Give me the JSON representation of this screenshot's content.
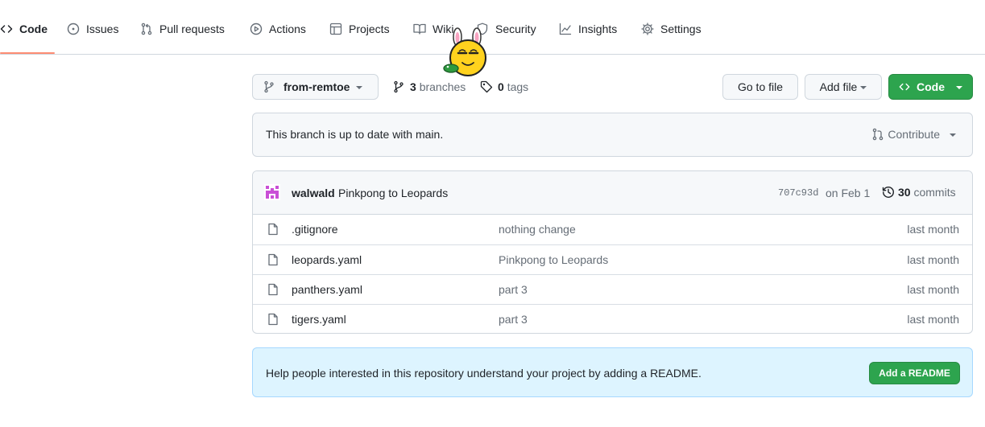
{
  "nav": {
    "items": [
      {
        "label": "Code",
        "icon": "code-icon",
        "selected": true
      },
      {
        "label": "Issues",
        "icon": "issue-opened-icon"
      },
      {
        "label": "Pull requests",
        "icon": "git-pull-request-icon"
      },
      {
        "label": "Actions",
        "icon": "play-icon"
      },
      {
        "label": "Projects",
        "icon": "table-icon"
      },
      {
        "label": "Wiki",
        "icon": "book-icon"
      },
      {
        "label": "Security",
        "icon": "shield-icon"
      },
      {
        "label": "Insights",
        "icon": "graph-icon"
      },
      {
        "label": "Settings",
        "icon": "gear-icon"
      }
    ]
  },
  "toolbar": {
    "branch": "from-remtoe",
    "branches_count": "3",
    "branches_label": "branches",
    "tags_count": "0",
    "tags_label": "tags",
    "go_to_file": "Go to file",
    "add_file": "Add file",
    "code": "Code"
  },
  "branch_status": {
    "message": "This branch is up to date with main.",
    "contribute": "Contribute"
  },
  "latest_commit": {
    "author": "walwald",
    "message": "Pinkpong to Leopards",
    "sha": "707c93d",
    "date": "on Feb 1",
    "commits_count": "30",
    "commits_label": "commits"
  },
  "files": [
    {
      "name": ".gitignore",
      "commit": "nothing change",
      "age": "last month"
    },
    {
      "name": "leopards.yaml",
      "commit": "Pinkpong to Leopards",
      "age": "last month"
    },
    {
      "name": "panthers.yaml",
      "commit": "part 3",
      "age": "last month"
    },
    {
      "name": "tigers.yaml",
      "commit": "part 3",
      "age": "last month"
    }
  ],
  "readme": {
    "message": "Help people interested in this repository understand your project by adding a README.",
    "button": "Add a README"
  },
  "colors": {
    "accent_underline": "#fd8c73",
    "primary_green": "#2da44e",
    "banner_blue": "#ddf4ff",
    "avatar_purple": "#c94fd6"
  }
}
